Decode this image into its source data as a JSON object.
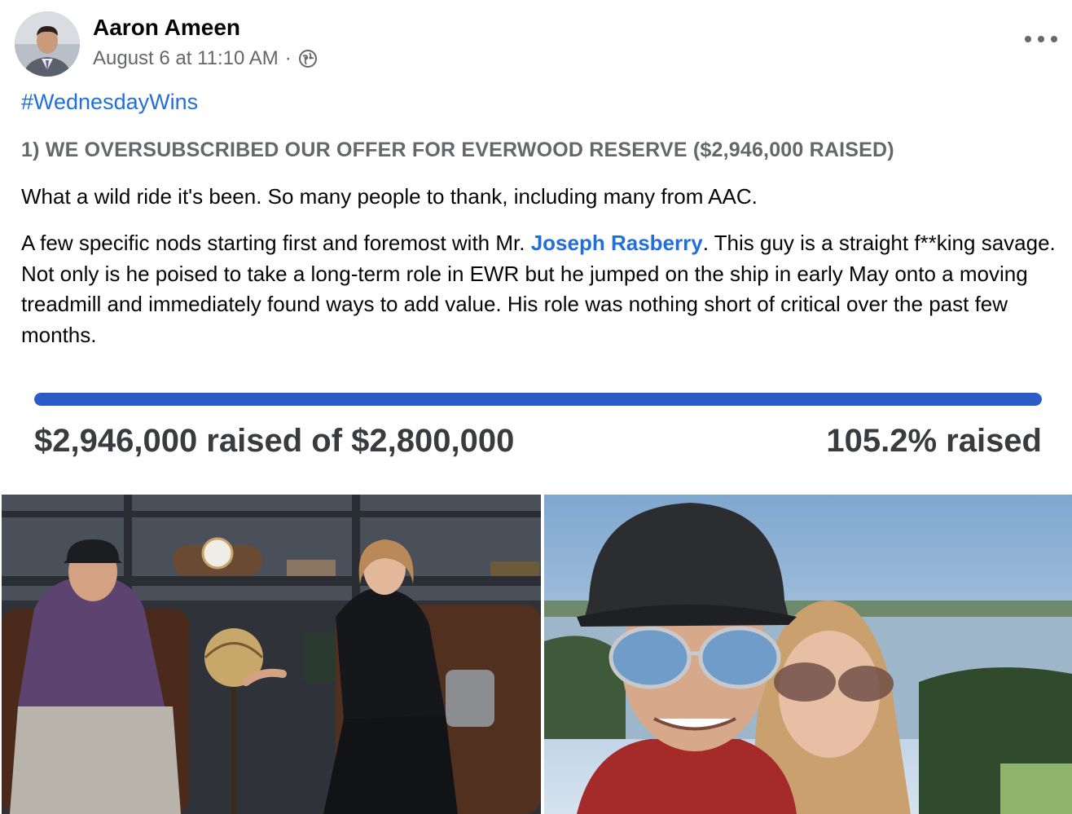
{
  "post": {
    "author": "Aaron Ameen",
    "timestamp": "August 6 at 11:10 AM",
    "separator": "·",
    "audience_icon": "globe-icon",
    "more_icon": "ellipsis-icon",
    "hashtag": "#WednesdayWins",
    "headline": "1) WE OVERSUBSCRIBED OUR OFFER FOR EVERWOOD RESERVE ($2,946,000 RAISED)",
    "paragraph1": "What a wild ride it's been. So many people to thank, including many from AAC.",
    "paragraph2_before": "A few specific nods starting first and foremost with Mr. ",
    "mention": "Joseph Rasberry",
    "paragraph2_after": ". This guy is a straight f**king savage. Not only is he poised to take a long-term role in EWR but he jumped on the ship in early May onto a moving treadmill and immediately found ways to add value. His role was nothing short of critical over the past few months."
  },
  "fundraise": {
    "raised_text": "$2,946,000 raised of $2,800,000",
    "percent_text": "105.2% raised",
    "progress_fraction": 1.0
  },
  "colors": {
    "link": "#216fdb",
    "progress": "#2a5bc6",
    "muted": "#65676b"
  }
}
